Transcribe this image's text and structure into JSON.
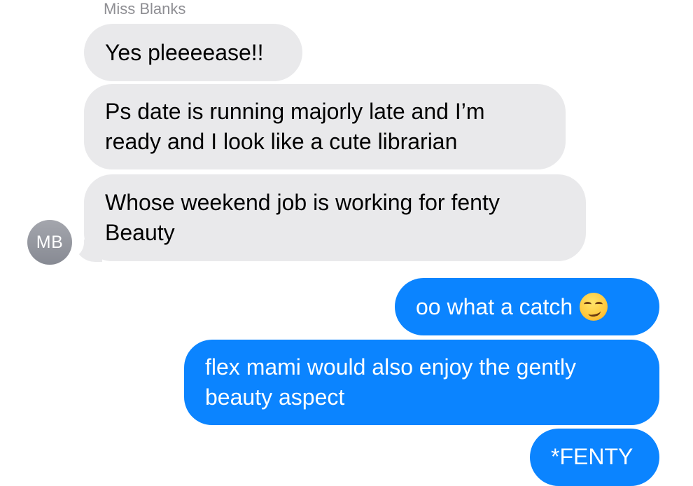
{
  "conversation": {
    "sender_name": "Miss Blanks",
    "avatar_initials": "MB",
    "received": [
      {
        "text": "Yes pleeeease!!"
      },
      {
        "text": "Ps date is running majorly late and I’m ready and I look like a cute librarian"
      },
      {
        "text": "Whose weekend job is working for fenty Beauty"
      }
    ],
    "sent": [
      {
        "text": "oo what a catch",
        "emoji": "smirk-emoji-icon"
      },
      {
        "text": "flex mami would also enjoy the gently beauty aspect"
      },
      {
        "text": "*FENTY"
      }
    ]
  },
  "colors": {
    "received_bubble": "#e9e9eb",
    "sent_bubble": "#0b84ff",
    "sender_name": "#8e8e93",
    "avatar": "#8e9098"
  }
}
